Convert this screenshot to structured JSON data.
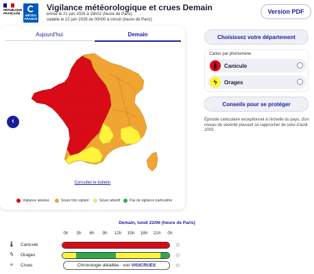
{
  "header": {
    "rf_lines": [
      "RÉPUBLIQUE",
      "FRANÇAISE"
    ],
    "mf_lines": [
      "MÉTÉO",
      "FRANCE"
    ],
    "title": "Vigilance météorologique et crues Demain",
    "emitted": "émise le 21 juin 2026 à 16h02 (heure de Paris)",
    "valid": "valable le 22 juin 2026 de 00h00 à minuit (heure de Paris)",
    "pdf_button": "Version PDF"
  },
  "tabs": [
    {
      "label": "Aujourd'hui",
      "active": false
    },
    {
      "label": "Demain",
      "active": true
    }
  ],
  "map": {
    "bulletin_link": "Consulter le bulletin",
    "colors": {
      "red": "#d90b17",
      "orange": "#f0a431",
      "yellow": "#fff33b",
      "green": "#32a84a"
    }
  },
  "legend": [
    {
      "label": "Vigilance absolue",
      "color": "#d90b17"
    },
    {
      "label": "Soyez très vigilant",
      "color": "#f0a431"
    },
    {
      "label": "Soyez attentif",
      "color": "#fff33b"
    },
    {
      "label": "Pas de vigilance particulière",
      "color": "#32a84a"
    }
  ],
  "panel": {
    "choose_department": "Choisissez votre département",
    "phenomena_heading": "Cartes par phénomène",
    "phenomena": [
      {
        "label": "Canicule",
        "icon": "thermometer-icon",
        "color": "#d90b17"
      },
      {
        "label": "Orages",
        "icon": "lightning-icon",
        "color": "#fff33b"
      }
    ],
    "advice_button": "Conseils pour se protéger",
    "comment": "Épisode caniculaire exceptionnel à l'échelle du pays, d'un niveau de sévérité pouvant se rapprocher de celui d'août 2003."
  },
  "timeline": {
    "title": "Demain, lundi 22/06 (heure de Paris)",
    "hours": [
      "0h",
      "3h",
      "6h",
      "9h",
      "12h",
      "15h",
      "18h",
      "21h",
      "0h"
    ],
    "rows": [
      {
        "label": "Canicule",
        "icon": "thermometer-icon",
        "segments": [
          {
            "color": "#d90b17",
            "span": 24
          }
        ]
      },
      {
        "label": "Orages",
        "icon": "lightning-icon",
        "segments": [
          {
            "color": "#fff33b",
            "span": 3
          },
          {
            "color": "#32a84a",
            "span": 9
          },
          {
            "color": "#fff33b",
            "span": 10
          },
          {
            "color": "#32a84a",
            "span": 2
          }
        ]
      },
      {
        "label": "Crues",
        "icon": "waves-icon"
      }
    ],
    "crues_button_prefix": "Chronologie détaillée : voir",
    "crues_button_brand": "VIGICRUES"
  }
}
